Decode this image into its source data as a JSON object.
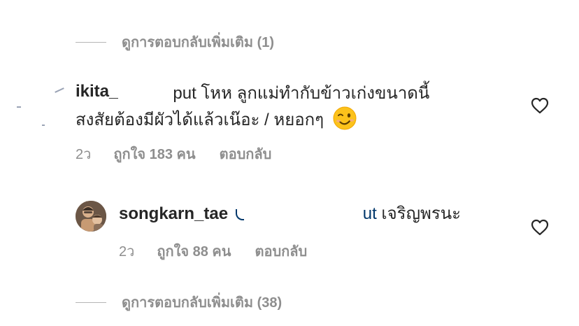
{
  "view_more_top": {
    "label": "ดูการตอบกลับเพิ่มเติม (1)"
  },
  "comment1": {
    "username_fragment": "ikita_",
    "username_fragment_end": "put",
    "line1_text": " โหห ลูกแม่ทำกับข้าวเก่งขนาดนี้",
    "line2_text": "สงสัยต้องมีผัวได้แล้วเน๊อะ / หยอกๆ",
    "emoji": "winking-face",
    "time": "2ว",
    "likes": "ถูกใจ 183 คน",
    "reply": "ตอบกลับ"
  },
  "comment2": {
    "username": "songkarn_tae",
    "mention_fragment": "ut",
    "text": " เจริญพรนะ",
    "time": "2ว",
    "likes": "ถูกใจ 88 คน",
    "reply": "ตอบกลับ"
  },
  "view_more_bottom": {
    "label": "ดูการตอบกลับเพิ่มเติม (38)"
  },
  "colors": {
    "primary_text": "#262626",
    "secondary_text": "#8e8e8e",
    "mention": "#00376b",
    "background": "#ffffff"
  }
}
